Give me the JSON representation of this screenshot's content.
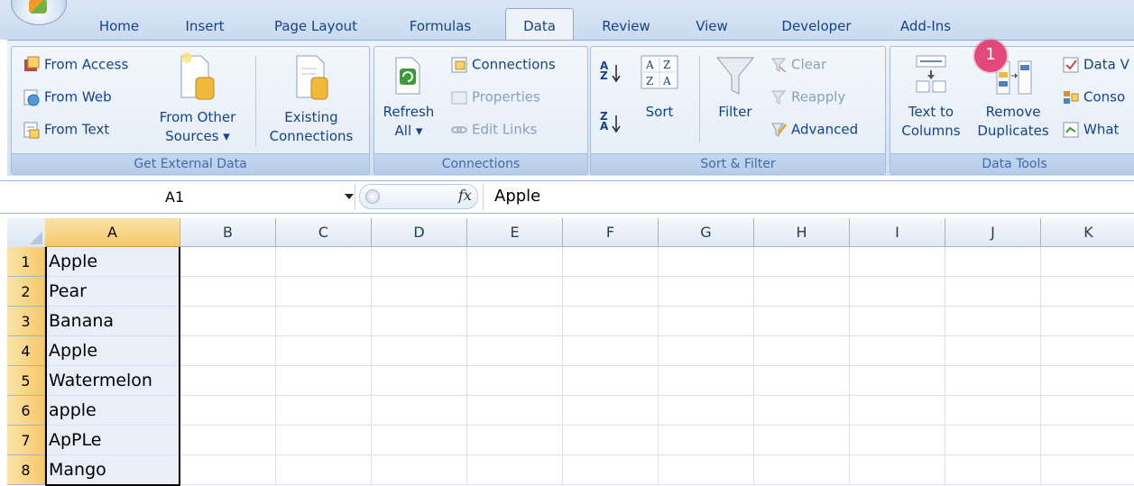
{
  "tabs": [
    "Home",
    "Insert",
    "Page Layout",
    "Formulas",
    "Data",
    "Review",
    "View",
    "Developer",
    "Add-Ins"
  ],
  "active_tab": "Data",
  "ribbon": {
    "external": {
      "label": "Get External Data",
      "from_access": "From Access",
      "from_web": "From Web",
      "from_text": "From Text",
      "from_other_1": "From Other",
      "from_other_2": "Sources ▾",
      "existing_1": "Existing",
      "existing_2": "Connections"
    },
    "connections": {
      "label": "Connections",
      "refresh_1": "Refresh",
      "refresh_2": "All ▾",
      "connections": "Connections",
      "properties": "Properties",
      "edit_links": "Edit Links"
    },
    "sortfilter": {
      "label": "Sort & Filter",
      "sort": "Sort",
      "filter": "Filter",
      "clear": "Clear",
      "reapply": "Reapply",
      "advanced": "Advanced",
      "az_top": "A",
      "az_bottom": "Z",
      "za_top": "Z",
      "za_bottom": "A"
    },
    "datatools": {
      "label": "Data Tools",
      "text_to_1": "Text to",
      "text_to_2": "Columns",
      "remove_1": "Remove",
      "remove_2": "Duplicates",
      "data_v": "Data V",
      "conso": "Conso",
      "what": "What"
    }
  },
  "callout": "1",
  "formula_bar": {
    "name_box": "A1",
    "fx": "fx",
    "content": "Apple"
  },
  "grid": {
    "columns": [
      "A",
      "B",
      "C",
      "D",
      "E",
      "F",
      "G",
      "H",
      "I",
      "J",
      "K"
    ],
    "rows": [
      "1",
      "2",
      "3",
      "4",
      "5",
      "6",
      "7",
      "8"
    ],
    "column_a_values": [
      "Apple",
      "Pear",
      "Banana",
      "Apple",
      "Watermelon",
      "apple",
      "ApPLe",
      "Mango"
    ]
  },
  "colors": {
    "callout": "#e4487a",
    "selected_header": "#f6c86a",
    "ribbon_text": "#15428b"
  }
}
